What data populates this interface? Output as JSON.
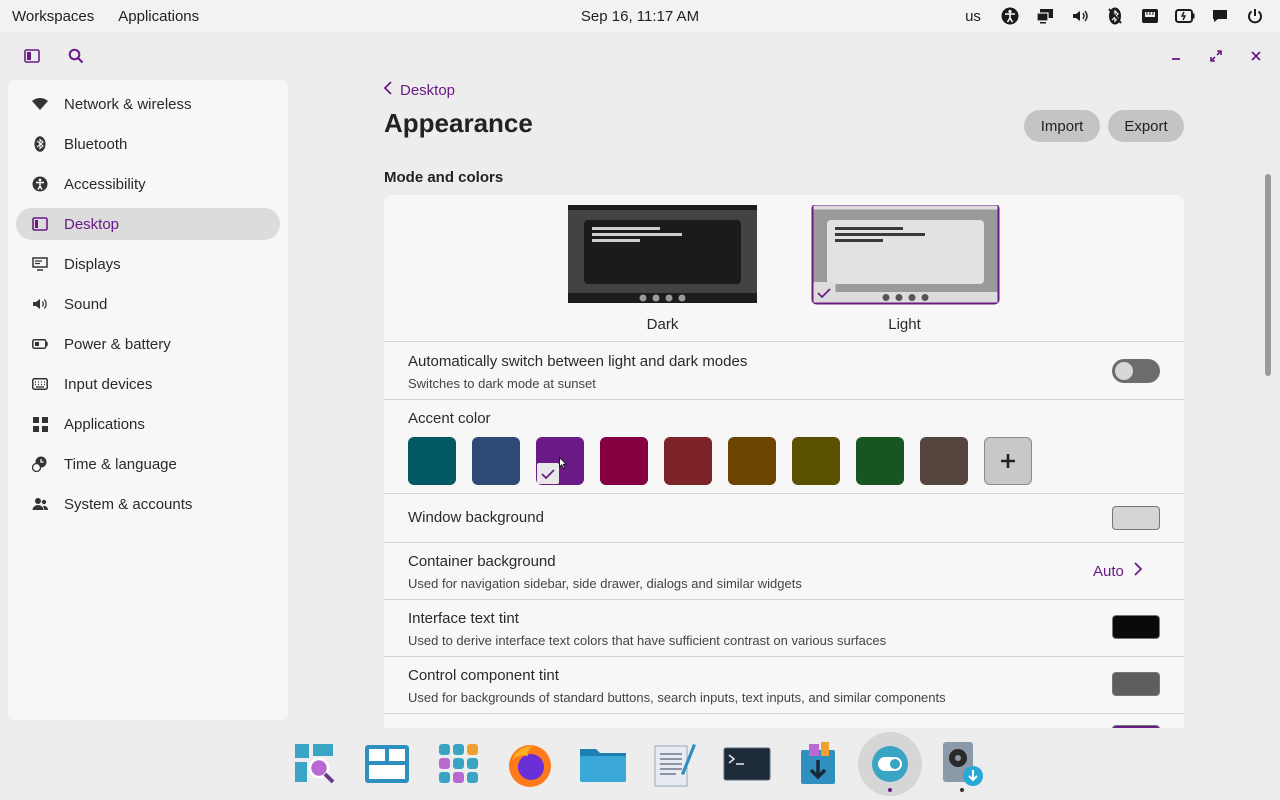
{
  "top_panel": {
    "workspaces_label": "Workspaces",
    "applications_label": "Applications",
    "clock": "Sep 16, 11:17 AM",
    "keyboard_layout": "us",
    "tray_icons": [
      "accessibility-icon",
      "display-icon",
      "volume-icon",
      "bluetooth-off-icon",
      "network-icon",
      "battery-icon",
      "notifications-icon",
      "power-icon"
    ]
  },
  "sidebar": {
    "items": [
      {
        "label": "Network & wireless",
        "icon": "wifi-icon"
      },
      {
        "label": "Bluetooth",
        "icon": "bluetooth-icon"
      },
      {
        "label": "Accessibility",
        "icon": "accessibility-icon"
      },
      {
        "label": "Desktop",
        "icon": "desktop-icon",
        "active": true
      },
      {
        "label": "Displays",
        "icon": "display-icon"
      },
      {
        "label": "Sound",
        "icon": "sound-icon"
      },
      {
        "label": "Power & battery",
        "icon": "battery-icon"
      },
      {
        "label": "Input devices",
        "icon": "keyboard-icon"
      },
      {
        "label": "Applications",
        "icon": "apps-grid-icon"
      },
      {
        "label": "Time & language",
        "icon": "clock-globe-icon"
      },
      {
        "label": "System & accounts",
        "icon": "users-icon"
      }
    ]
  },
  "main": {
    "back_label": "Desktop",
    "title": "Appearance",
    "import_label": "Import",
    "export_label": "Export",
    "section_title": "Mode and colors",
    "modes": [
      {
        "label": "Dark",
        "selected": false
      },
      {
        "label": "Light",
        "selected": true
      }
    ],
    "auto_switch": {
      "title": "Automatically switch between light and dark modes",
      "subtitle": "Switches to dark mode at sunset",
      "enabled": false
    },
    "accent": {
      "title": "Accent color",
      "colors": [
        "#045a64",
        "#2f4a75",
        "#6a1b86",
        "#840040",
        "#7c2427",
        "#6b4400",
        "#5a5000",
        "#195523",
        "#54453f"
      ],
      "selected_index": 2
    },
    "window_background": {
      "title": "Window background",
      "color": "#d4d4d4"
    },
    "container_background": {
      "title": "Container background",
      "subtitle": "Used for navigation sidebar, side drawer, dialogs and similar widgets",
      "value": "Auto"
    },
    "interface_text_tint": {
      "title": "Interface text tint",
      "subtitle": "Used to derive interface text colors that have sufficient contrast on various surfaces",
      "color": "#0a0a0a"
    },
    "control_component_tint": {
      "title": "Control component tint",
      "subtitle": "Used for backgrounds of standard buttons, search inputs, text inputs, and similar components",
      "color": "#5e5e5e"
    }
  },
  "dock": {
    "items": [
      "launcher-search-icon",
      "workspaces-icon",
      "app-library-icon",
      "firefox-icon",
      "files-icon",
      "text-editor-icon",
      "terminal-icon",
      "app-store-icon",
      "settings-icon",
      "installer-icon"
    ],
    "active_index": 8
  },
  "colors": {
    "accent": "#6a1b86",
    "panel": "#f2f2f2",
    "sidebar": "#f7f7f7"
  }
}
